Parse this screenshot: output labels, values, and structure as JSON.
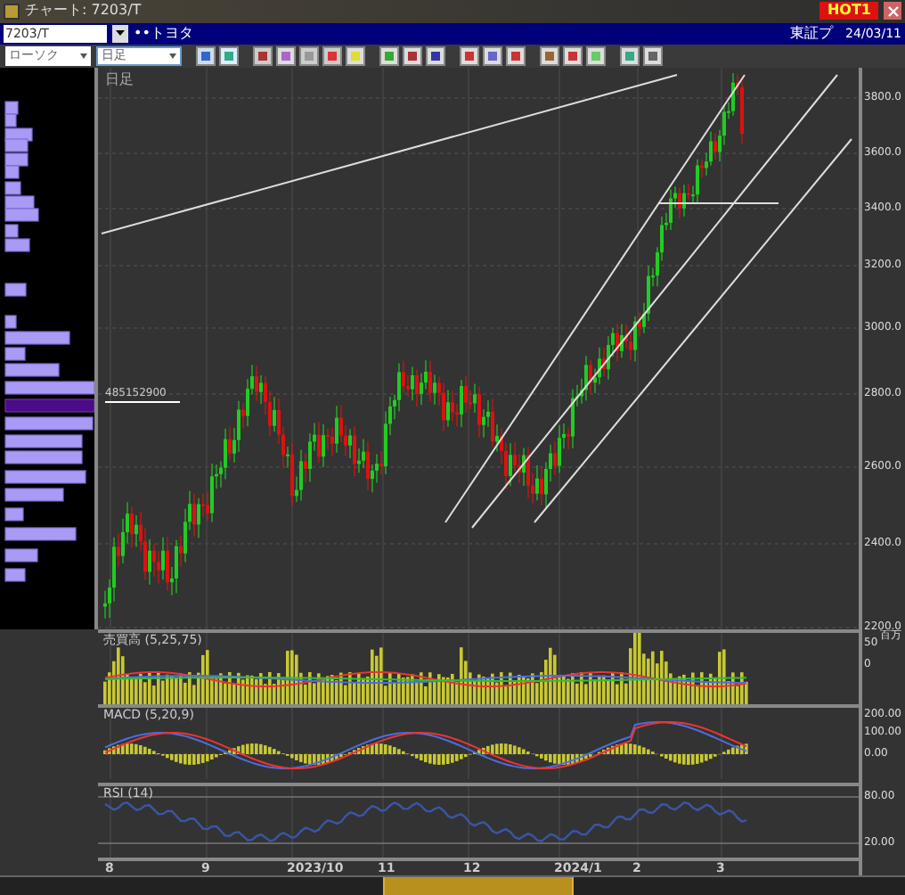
{
  "window": {
    "title": "チャート: 7203/T",
    "hot_label": "HOT1"
  },
  "symbol_bar": {
    "code": "7203/T",
    "name": "••トヨタ",
    "market": "東証プ",
    "date": "24/03/11"
  },
  "toolbar": {
    "chart_type": "ローソク",
    "period": "日足"
  },
  "main_chart": {
    "label": "日足",
    "price_marker": "485152900",
    "price_ticks": [
      "3800.0",
      "3600.0",
      "3400.0",
      "3200.0",
      "3000.0",
      "2800.0",
      "2600.0",
      "2400.0",
      "2200.0"
    ]
  },
  "indicators": [
    {
      "kind": "volume",
      "label": "売買高 (5,25,75)",
      "unit": "百万",
      "ticks": [
        "50",
        "0"
      ]
    },
    {
      "kind": "macd",
      "label": "MACD (5,20,9)",
      "ticks": [
        "200.00",
        "100.00",
        "0.00"
      ]
    },
    {
      "kind": "rsi",
      "label": "RSI (14)",
      "ticks": [
        "80.00",
        "20.00"
      ]
    }
  ],
  "x_axis": [
    "8",
    "9",
    "2023/10",
    "11",
    "12",
    "2024/1",
    "2",
    "3"
  ]
}
